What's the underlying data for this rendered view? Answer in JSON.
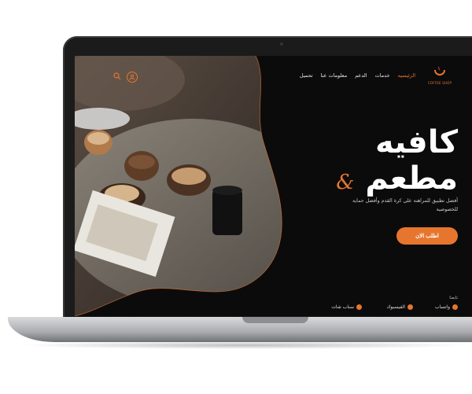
{
  "nav": {
    "items": [
      {
        "label": "الرئيسيه",
        "active": true
      },
      {
        "label": "خدمات"
      },
      {
        "label": "الدعم"
      },
      {
        "label": "معلومات عنا"
      },
      {
        "label": "تحميل"
      }
    ],
    "logo_text": "COFFEE SHOP"
  },
  "hero": {
    "line1": "كافيه",
    "line2": "مطعم",
    "amp": "&",
    "description": "أفضل تطبيق للمراهنة على كرة القدم وأفضل حماية للخصوصية",
    "cta": "اطلب الان"
  },
  "follow": {
    "title": "تابعنا",
    "links": [
      {
        "label": "واتساب",
        "icon": "whatsapp-icon"
      },
      {
        "label": "الفيسبوك",
        "icon": "facebook-icon"
      },
      {
        "label": "سناب شات",
        "icon": "snapchat-icon"
      }
    ]
  },
  "colors": {
    "accent": "#e6762e",
    "background": "#0b0b0c",
    "text": "#ffffff"
  }
}
